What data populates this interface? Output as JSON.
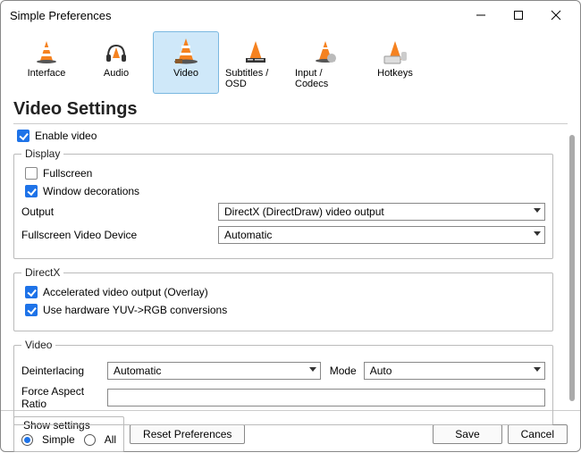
{
  "window": {
    "title": "Simple Preferences"
  },
  "tabs": {
    "interface": "Interface",
    "audio": "Audio",
    "video": "Video",
    "subtitles": "Subtitles / OSD",
    "input": "Input / Codecs",
    "hotkeys": "Hotkeys"
  },
  "heading": "Video Settings",
  "enable_video": {
    "label": "Enable video",
    "checked": true
  },
  "display": {
    "legend": "Display",
    "fullscreen": {
      "label": "Fullscreen",
      "checked": false
    },
    "window_decorations": {
      "label": "Window decorations",
      "checked": true
    },
    "output_label": "Output",
    "output_value": "DirectX (DirectDraw) video output",
    "device_label": "Fullscreen Video Device",
    "device_value": "Automatic"
  },
  "directx": {
    "legend": "DirectX",
    "overlay": {
      "label": "Accelerated video output (Overlay)",
      "checked": true
    },
    "yuv": {
      "label": "Use hardware YUV->RGB conversions",
      "checked": true
    }
  },
  "video": {
    "legend": "Video",
    "deint_label": "Deinterlacing",
    "deint_value": "Automatic",
    "mode_label": "Mode",
    "mode_value": "Auto",
    "aspect_label": "Force Aspect Ratio",
    "aspect_value": ""
  },
  "footer": {
    "show_settings": "Show settings",
    "simple": "Simple",
    "all": "All",
    "reset": "Reset Preferences",
    "save": "Save",
    "cancel": "Cancel"
  }
}
